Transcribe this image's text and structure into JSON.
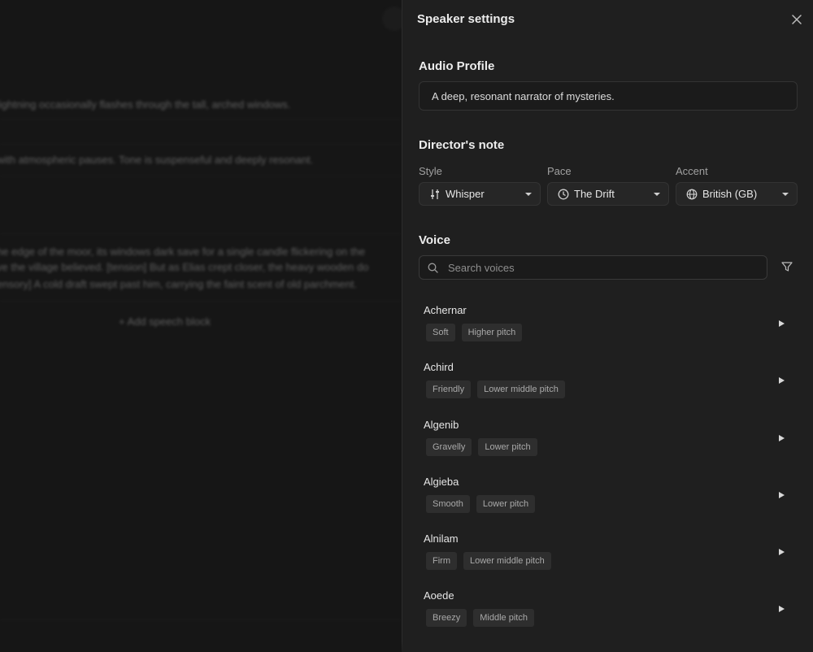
{
  "editor": {
    "lines": [
      "lightning occasionally flashes through the tall, arched windows.",
      "with atmospheric pauses. Tone is suspenseful and deeply resonant.",
      "he edge of the moor, its windows dark save for a single candle flickering on the",
      "ve the village believed. [tension] But as Elias crept closer, the heavy wooden do",
      "ensory] A cold draft swept past him, carrying the faint scent of old parchment."
    ],
    "add_block_label": "+ Add speech block"
  },
  "panel": {
    "title": "Speaker settings",
    "audio_profile": {
      "heading": "Audio Profile",
      "value": "A deep, resonant narrator of mysteries."
    },
    "directors_note": {
      "heading": "Director's note",
      "style": {
        "label": "Style",
        "value": "Whisper",
        "icon": "sliders-icon"
      },
      "pace": {
        "label": "Pace",
        "value": "The Drift",
        "icon": "clock-icon"
      },
      "accent": {
        "label": "Accent",
        "value": "British (GB)",
        "icon": "globe-icon"
      }
    },
    "voice": {
      "heading": "Voice",
      "search_placeholder": "Search voices",
      "items": [
        {
          "name": "Achernar",
          "tags": [
            "Soft",
            "Higher pitch"
          ]
        },
        {
          "name": "Achird",
          "tags": [
            "Friendly",
            "Lower middle pitch"
          ]
        },
        {
          "name": "Algenib",
          "tags": [
            "Gravelly",
            "Lower pitch"
          ]
        },
        {
          "name": "Algieba",
          "tags": [
            "Smooth",
            "Lower pitch"
          ]
        },
        {
          "name": "Alnilam",
          "tags": [
            "Firm",
            "Lower middle pitch"
          ]
        },
        {
          "name": "Aoede",
          "tags": [
            "Breezy",
            "Middle pitch"
          ]
        }
      ]
    }
  },
  "colors": {
    "background": "#161616",
    "panel": "#1f1f1f",
    "tag_bg": "#2e2e2e",
    "text": "#e6e6e6"
  }
}
